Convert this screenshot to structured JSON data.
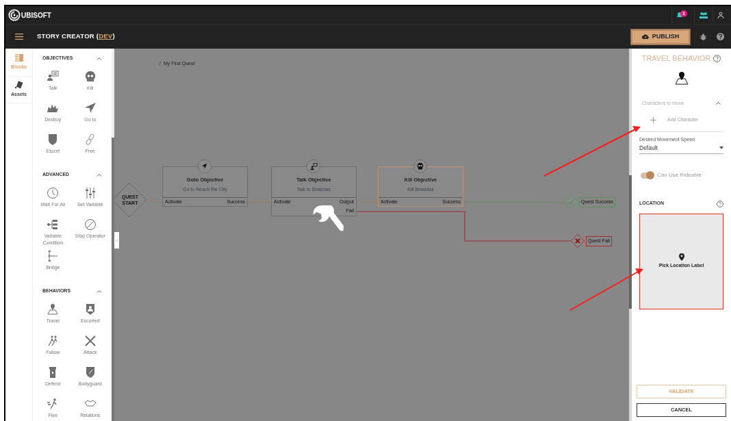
{
  "header": {
    "brand": "UBISOFT",
    "notification_count": "1",
    "title": "STORY CREATOR (",
    "env": "DEV",
    "title_end": ")",
    "publish": "PUBLISH"
  },
  "sidebar": {
    "tabs": [
      {
        "label": "Blocks",
        "selected": true
      },
      {
        "label": "Assets",
        "selected": false
      }
    ],
    "sections": [
      {
        "title": "OBJECTIVES",
        "expanded": true,
        "items": [
          "Talk",
          "Kill",
          "Destroy",
          "Go to",
          "Escort",
          "Free"
        ]
      },
      {
        "title": "ADVANCED",
        "expanded": true,
        "items": [
          "Wait For All",
          "Set Variable",
          "Variable Condition",
          "Stop Operator",
          "Bridge"
        ]
      },
      {
        "title": "BEHAVIORS",
        "expanded": true,
        "items": [
          "Travel",
          "Escorted",
          "Follow",
          "Attack",
          "Defend",
          "Bodyguard",
          "Flee",
          "Relations"
        ]
      }
    ]
  },
  "canvas": {
    "breadcrumb": [
      "/",
      "My First Quest"
    ],
    "start": "QUEST START",
    "nodes": [
      {
        "title": "Goto Objective",
        "subtitle": "Go to Reach the City",
        "selected": false,
        "ports": [
          "Activate",
          "Success"
        ]
      },
      {
        "title": "Talk Objective",
        "subtitle": "Talk to Brasidas",
        "selected": false,
        "ports": [
          "Activate",
          "Output",
          "Fail"
        ]
      },
      {
        "title": "Kill Objective",
        "subtitle": "Kill Brasidas",
        "selected": true,
        "ports": [
          "Activate",
          "Success"
        ]
      }
    ],
    "outcomes": [
      {
        "kind": "success",
        "label": "Quest Success"
      },
      {
        "kind": "fail",
        "label": "Quest Fail"
      }
    ]
  },
  "panel": {
    "title": "TRAVEL BEHAVIOR",
    "characters_label": "Characters to move",
    "characters_expanded": true,
    "add_character": "Add Character",
    "speed_label": "Desired Movement Speed",
    "speed_value": "Default",
    "rideable_label": "Can Use Rideable",
    "rideable_on": true,
    "location_label": "LOCATION",
    "location_pick": "Pick Location Label",
    "validate": "VALIDATE",
    "cancel": "CANCEL"
  }
}
